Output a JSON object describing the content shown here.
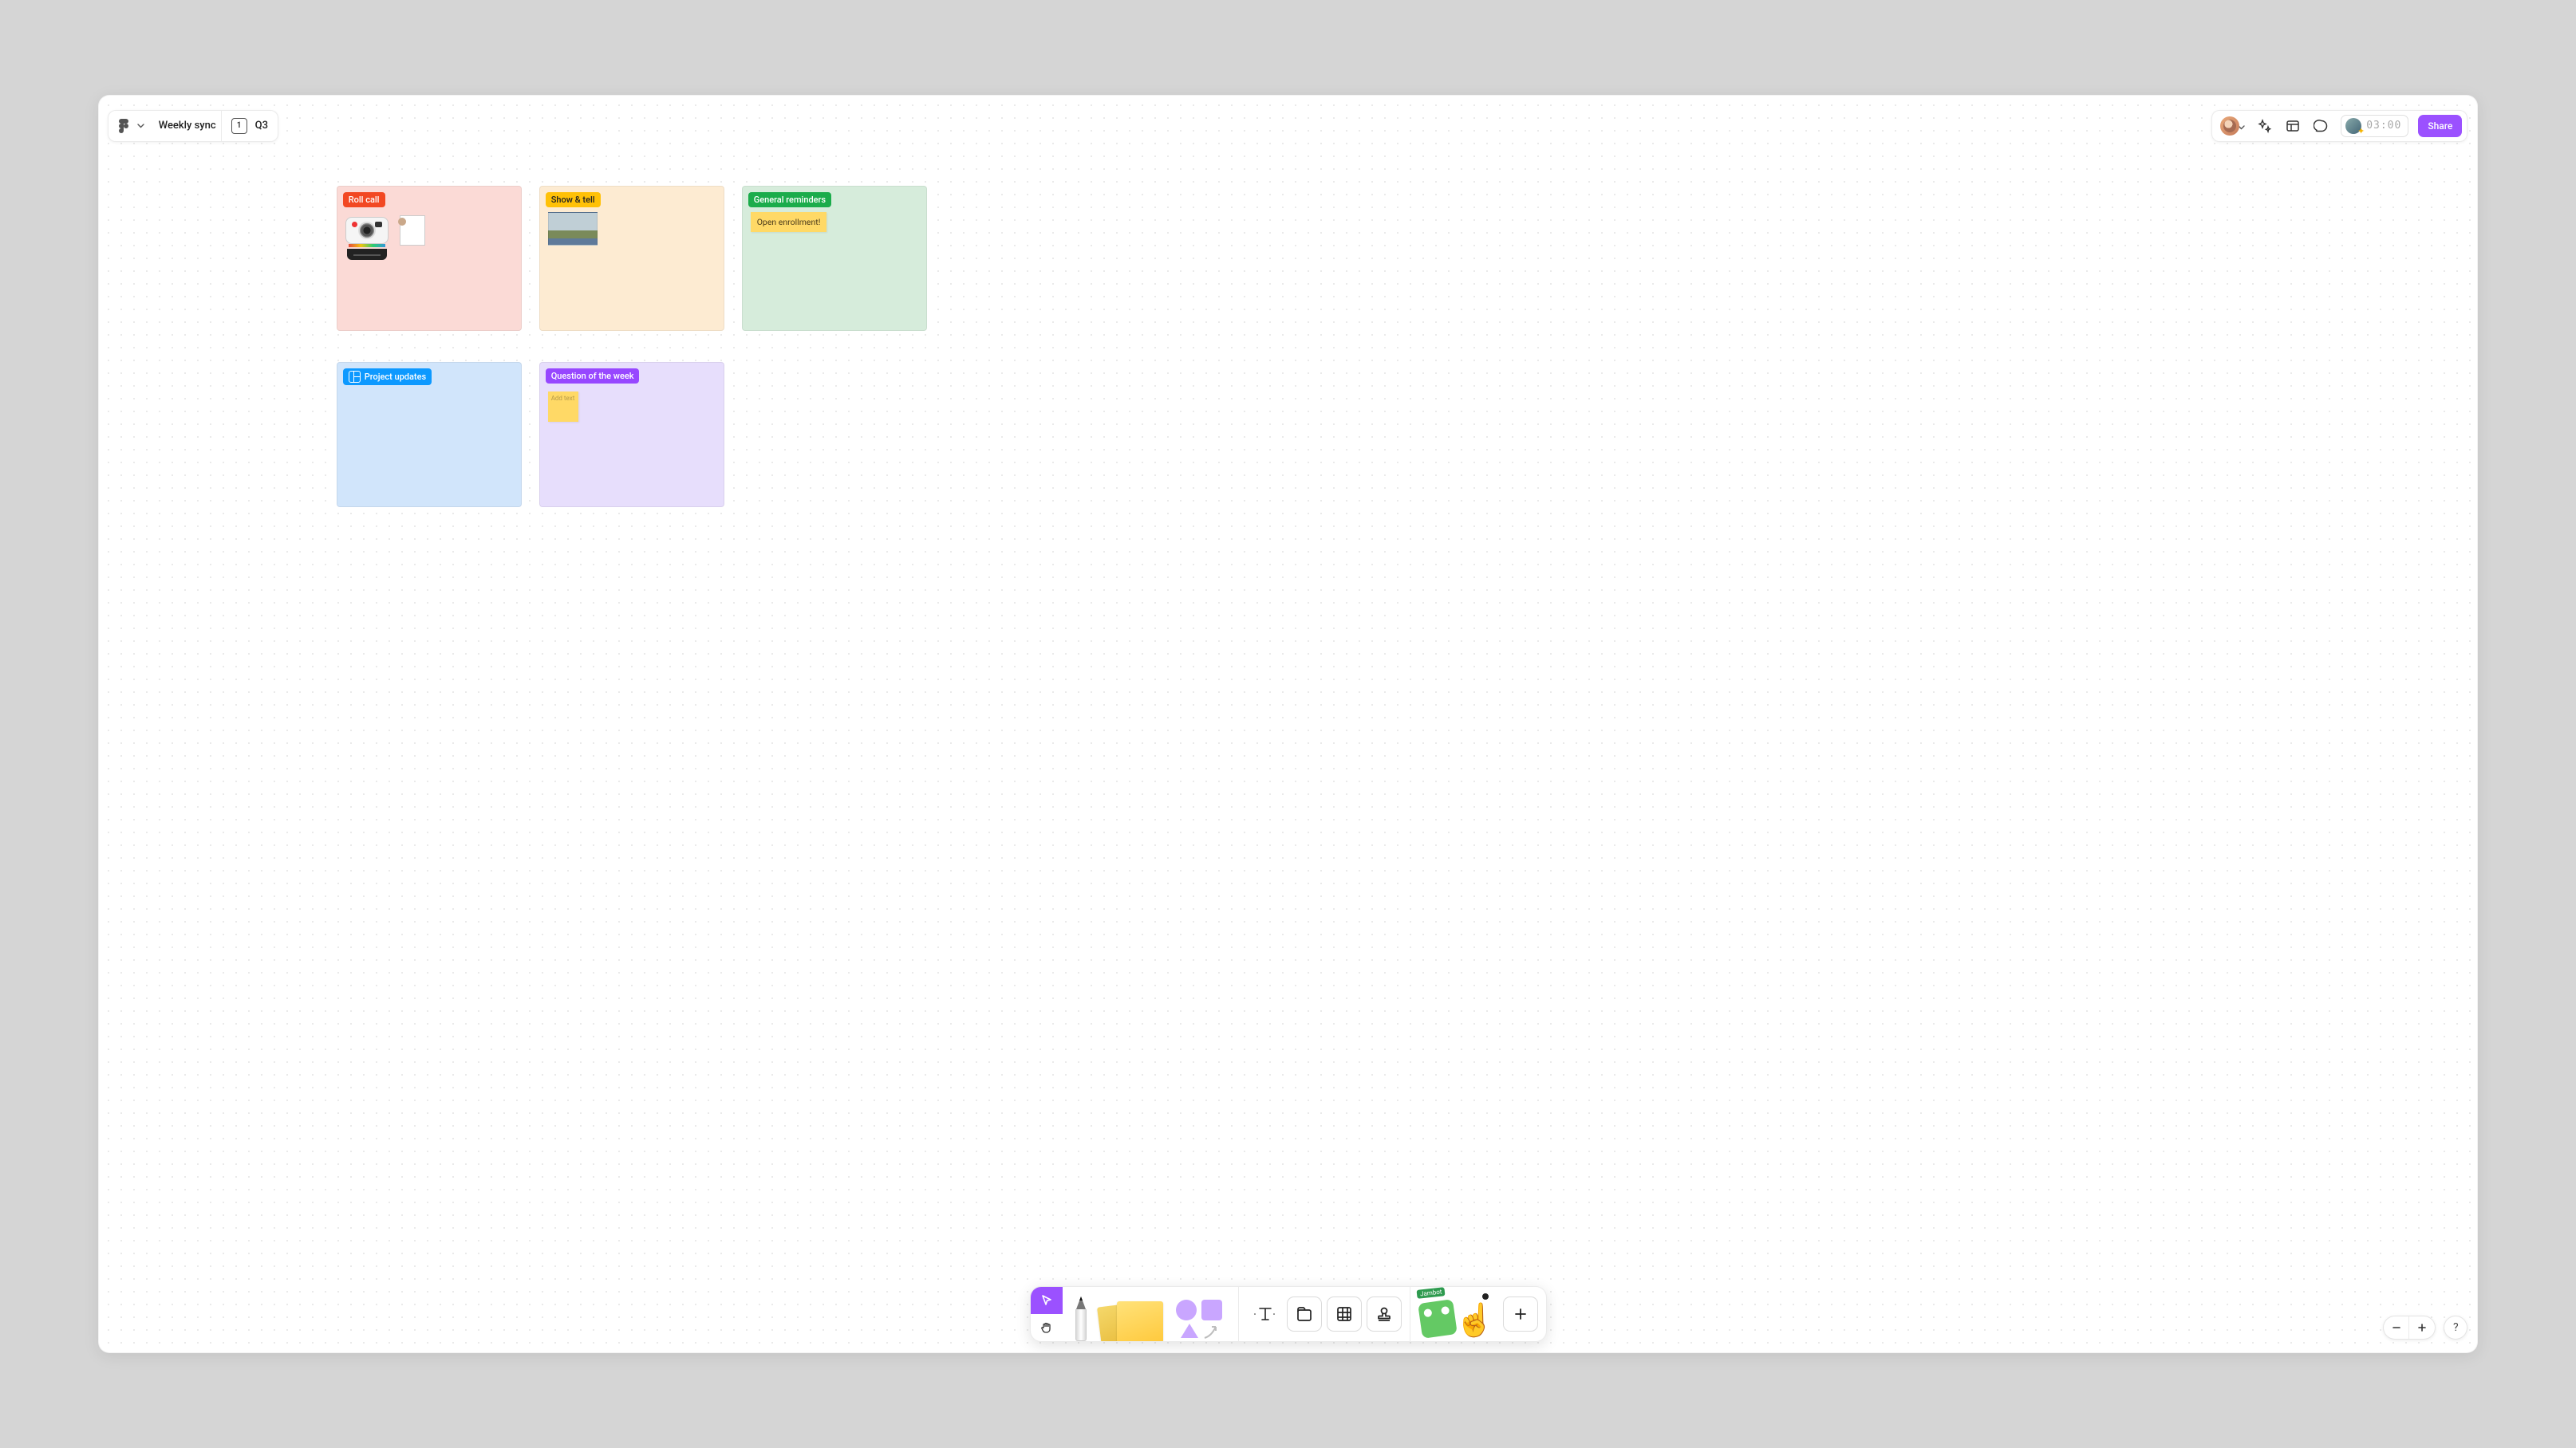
{
  "header": {
    "file_name": "Weekly sync",
    "page_number": "1",
    "page_name": "Q3"
  },
  "topbar": {
    "timer": "03:00",
    "share_label": "Share"
  },
  "sections": {
    "roll_call": {
      "label": "Roll call"
    },
    "show_tell": {
      "label": "Show & tell"
    },
    "general_reminders": {
      "label": "General reminders",
      "sticky_text": "Open enrollment!"
    },
    "project_updates": {
      "label": "Project updates"
    },
    "question": {
      "label": "Question of the week",
      "sticky_placeholder": "Add text"
    }
  },
  "widgets": {
    "jambot_label": "Jambot"
  },
  "help": {
    "label": "?"
  }
}
